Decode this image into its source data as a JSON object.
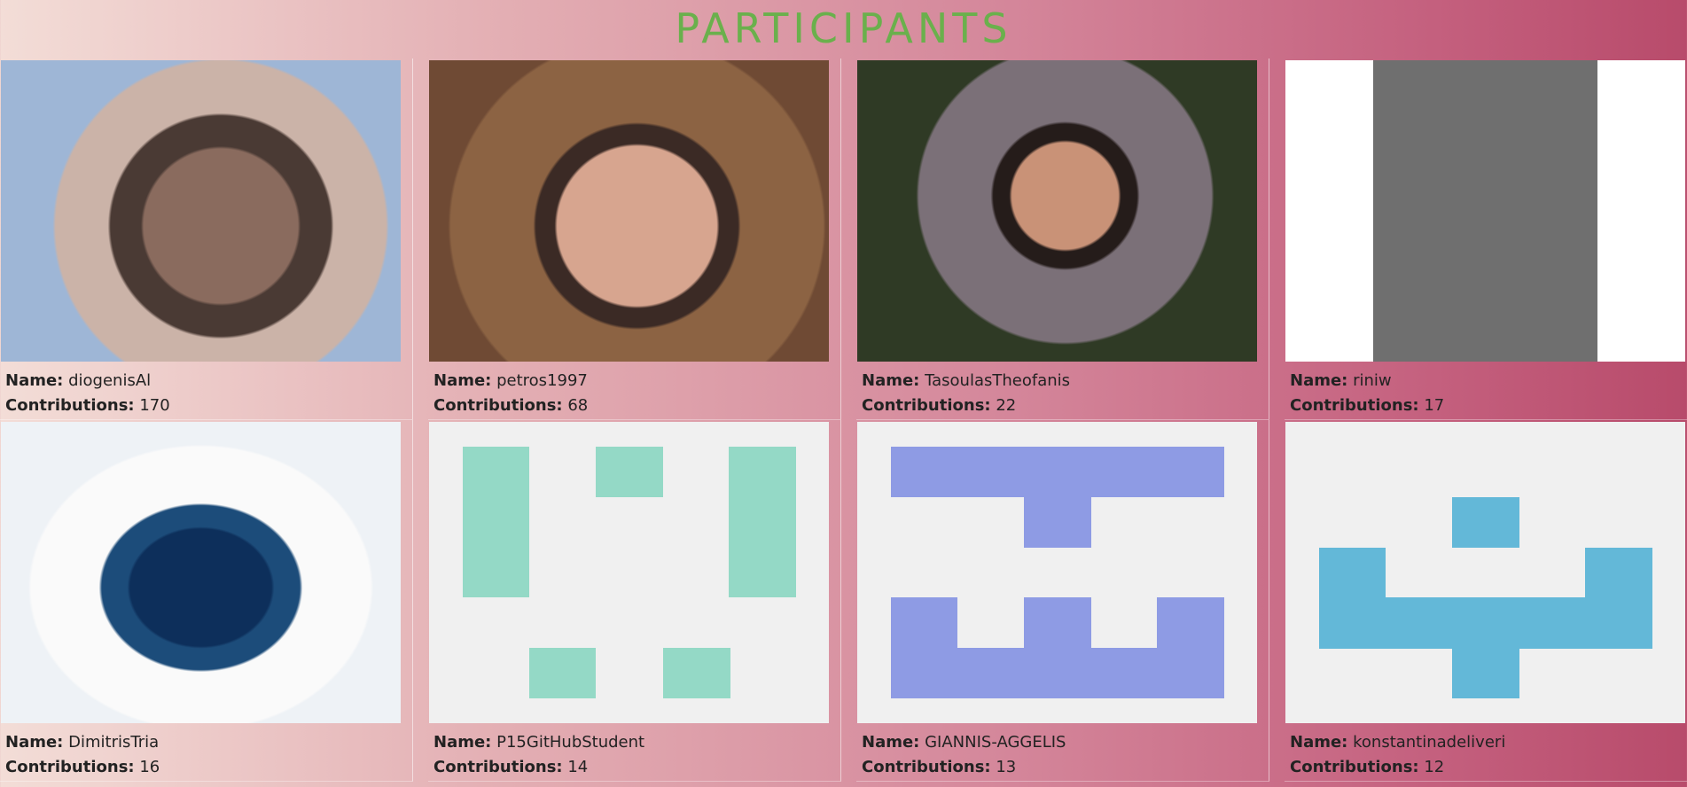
{
  "page": {
    "title": "PARTICIPANTS"
  },
  "labels": {
    "name": "Name:",
    "contributions": "Contributions:"
  },
  "colors": {
    "title": "#6ab04c",
    "identicon_green": "#94d9c6",
    "identicon_purple": "#8e9be4",
    "identicon_blue": "#63b8d8"
  },
  "participants": [
    {
      "name": "diogenisAl",
      "contributions": "170"
    },
    {
      "name": "petros1997",
      "contributions": "68"
    },
    {
      "name": "TasoulasTheofanis",
      "contributions": "22"
    },
    {
      "name": "riniw",
      "contributions": "17"
    },
    {
      "name": "DimitrisTria",
      "contributions": "16"
    },
    {
      "name": "P15GitHubStudent",
      "contributions": "14"
    },
    {
      "name": "GIANNIS-AGGELIS",
      "contributions": "13"
    },
    {
      "name": "konstantinadeliveri",
      "contributions": "12"
    }
  ]
}
